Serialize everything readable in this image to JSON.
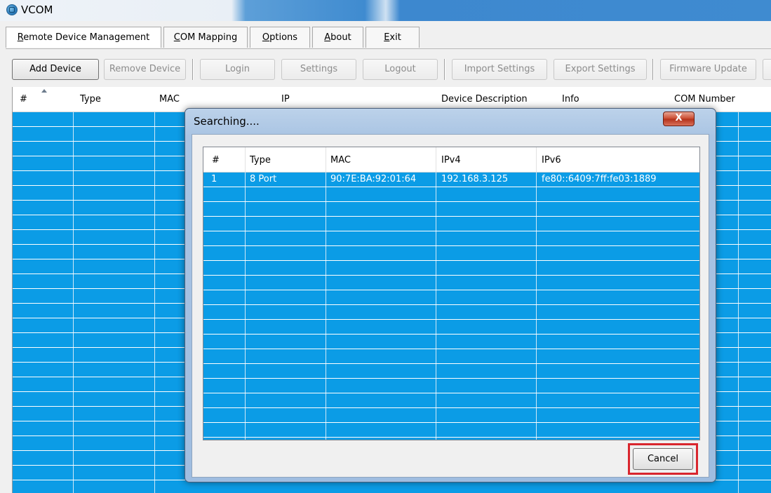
{
  "window": {
    "title": "VCOM",
    "icon": "app-globe-icon"
  },
  "menu": {
    "tabs": [
      {
        "prefix": "R",
        "rest": "emote Device Management"
      },
      {
        "prefix": "C",
        "rest": "OM Mapping"
      },
      {
        "prefix": "O",
        "rest": "ptions"
      },
      {
        "prefix": "A",
        "rest": "bout"
      },
      {
        "prefix": "E",
        "rest": "xit"
      }
    ]
  },
  "toolbar": {
    "add_device": "Add Device",
    "remove_device": "Remove Device",
    "login": "Login",
    "settings": "Settings",
    "logout": "Logout",
    "import_settings": "Import Settings",
    "export_settings": "Export Settings",
    "firmware_update": "Firmware Update"
  },
  "device_list": {
    "columns": [
      "#",
      "Type",
      "MAC",
      "IP",
      "Device Description",
      "Info",
      "COM Number"
    ],
    "row_color": "#0b9ce6"
  },
  "search_dialog": {
    "title": "Searching....",
    "close_label": "X",
    "columns": [
      "#",
      "Type",
      "MAC",
      "IPv4",
      "IPv6"
    ],
    "rows": [
      [
        "1",
        "8 Port",
        "90:7E:BA:92:01:64",
        "192.168.3.125",
        "fe80::6409:7ff:fe03:1889"
      ]
    ],
    "cancel_label": "Cancel",
    "highlight_color": "#d9262e"
  }
}
